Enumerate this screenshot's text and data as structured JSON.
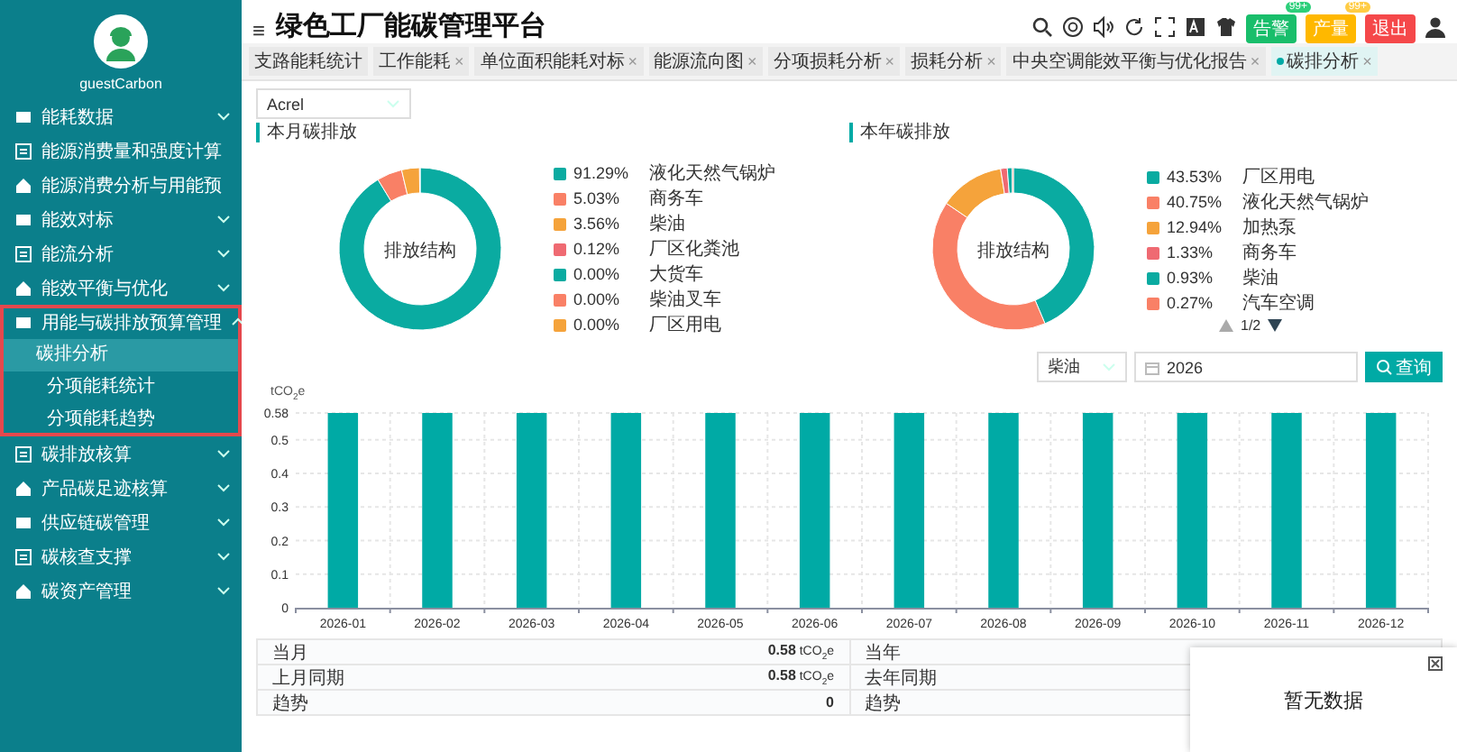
{
  "sidebar": {
    "user": "guestCarbon",
    "items": [
      {
        "label": "能耗数据",
        "expandable": true,
        "expanded": false
      },
      {
        "label": "能源消费量和强度计算",
        "expandable": false,
        "expanded": false
      },
      {
        "label": "能源消费分析与用能预",
        "expandable": false,
        "expanded": false
      },
      {
        "label": "能效对标",
        "expandable": true,
        "expanded": false
      },
      {
        "label": "能流分析",
        "expandable": true,
        "expanded": false
      },
      {
        "label": "能效平衡与优化",
        "expandable": true,
        "expanded": false
      },
      {
        "label": "用能与碳排放预算管理",
        "expandable": true,
        "expanded": true,
        "children": [
          {
            "label": "碳排分析",
            "selected": true
          },
          {
            "label": "分项能耗统计",
            "selected": false
          },
          {
            "label": "分项能耗趋势",
            "selected": false
          }
        ]
      },
      {
        "label": "碳排放核算",
        "expandable": true,
        "expanded": false
      },
      {
        "label": "产品碳足迹核算",
        "expandable": true,
        "expanded": false
      },
      {
        "label": "供应链碳管理",
        "expandable": true,
        "expanded": false
      },
      {
        "label": "碳核查支撑",
        "expandable": true,
        "expanded": false
      },
      {
        "label": "碳资产管理",
        "expandable": true,
        "expanded": false
      }
    ]
  },
  "header": {
    "menu_glyph": "≡",
    "title": "绿色工厂能碳管理平台",
    "badges": [
      {
        "label": "告警",
        "count": "99+",
        "color": "#19be6b"
      },
      {
        "label": "产量",
        "count": "99+",
        "color": "#ffb800"
      },
      {
        "label": "退出",
        "color": "#f5484a"
      }
    ]
  },
  "tabs": [
    {
      "label": "支路能耗统计",
      "selected": false
    },
    {
      "label": "工作能耗",
      "close": "×",
      "selected": false
    },
    {
      "label": "单位面积能耗对标",
      "close": "×",
      "selected": false
    },
    {
      "label": "能源流向图",
      "close": "×",
      "selected": false
    },
    {
      "label": "分项损耗分析",
      "close": "×",
      "selected": false
    },
    {
      "label": "损耗分析",
      "close": "×",
      "selected": false
    },
    {
      "label": "中央空调能效平衡与优化报告",
      "close": "×",
      "selected": false
    },
    {
      "label": "碳排分析",
      "close": "×",
      "selected": true
    }
  ],
  "site_select": {
    "value": "Acrel"
  },
  "panels": [
    {
      "title": "本月碳排放",
      "chart_data": {
        "type": "donut",
        "title": "排放结构",
        "categories": [
          "液化天然气锅炉",
          "商务车",
          "柴油",
          "厂区化粪池",
          "大货车",
          "柴油叉车",
          "厂区用电"
        ],
        "values": [
          91.29,
          5.03,
          3.56,
          0.12,
          0,
          0,
          0
        ],
        "value_labels": [
          "91.29%",
          "5.03%",
          "3.56%",
          "0.12%",
          "0.00%",
          "0.00%",
          "0.00%"
        ],
        "colors": [
          "#0aaba1",
          "#f98066",
          "#f5a33b",
          "#ef6a72",
          "#0aaba1",
          "#f98066",
          "#f5a33b"
        ]
      }
    },
    {
      "title": "本年碳排放",
      "pager": "1/2",
      "chart_data": {
        "type": "donut",
        "title": "排放结构",
        "categories": [
          "厂区用电",
          "液化天然气锅炉",
          "加热泵",
          "商务车",
          "柴油",
          "汽车空调"
        ],
        "values": [
          43.53,
          40.75,
          12.94,
          1.33,
          0.93,
          0.27
        ],
        "value_labels": [
          "43.53%",
          "40.75%",
          "12.94%",
          "1.33%",
          "0.93%",
          "0.27%"
        ],
        "colors": [
          "#0aaba1",
          "#f98066",
          "#f5a33b",
          "#ef6a72",
          "#0aaba1",
          "#f98066"
        ]
      }
    }
  ],
  "filters": {
    "energy": "柴油",
    "year": "2026",
    "query_button": "查询"
  },
  "bar_chart": {
    "chart_data": {
      "type": "bar",
      "ylabel": "tCO$_{2}$e",
      "grid": true,
      "categories": [
        "2026-01",
        "2026-02",
        "2026-03",
        "2026-04",
        "2026-05",
        "2026-06",
        "2026-07",
        "2026-08",
        "2026-09",
        "2026-10",
        "2026-11",
        "2026-12"
      ],
      "values": [
        0.58,
        0.58,
        0.58,
        0.58,
        0.58,
        0.58,
        0.58,
        0.58,
        0.58,
        0.58,
        0.58,
        0.58
      ],
      "ylim": [
        0,
        0.58
      ],
      "yticks": [
        0,
        0.1,
        0.2,
        0.3,
        0.4,
        0.5,
        {
          "value": 0.58,
          "label": "0.58"
        }
      ]
    }
  },
  "stats": {
    "month": [
      {
        "label": "当月",
        "value": "0.58",
        "unit": "tCO$_{2}$e"
      },
      {
        "label": "上月同期",
        "value": "0.58",
        "unit": "tCO$_{2}$e"
      },
      {
        "label": "趋势",
        "value": "0"
      }
    ],
    "year": [
      {
        "label": "当年"
      },
      {
        "label": "去年同期"
      },
      {
        "label": "趋势"
      }
    ]
  },
  "popup": {
    "message": "暂无数据"
  }
}
